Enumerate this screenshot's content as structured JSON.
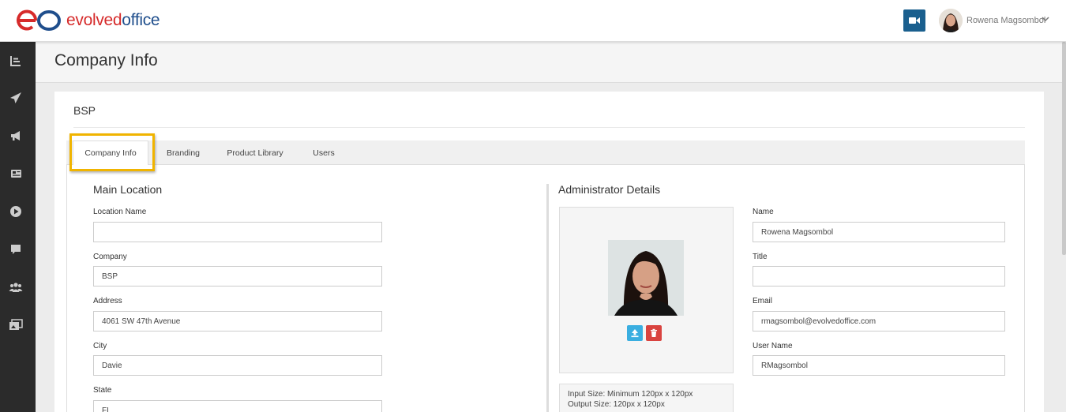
{
  "brand": {
    "word1": "evolved",
    "word2": "office",
    "red": "#d62b2b",
    "blue": "#1f4e8c"
  },
  "topbar": {
    "video_icon": "video-camera-icon",
    "user_name": "Rowena Magsombol"
  },
  "sidebar": {
    "icons": [
      "chart-bar-icon",
      "paper-plane-icon",
      "megaphone-icon",
      "newspaper-icon",
      "play-circle-icon",
      "comment-icon",
      "users-icon",
      "images-icon"
    ]
  },
  "page": {
    "title": "Company Info"
  },
  "card": {
    "company_name": "BSP"
  },
  "tabs": [
    {
      "label": "Company Info",
      "active": true
    },
    {
      "label": "Branding"
    },
    {
      "label": "Product Library"
    },
    {
      "label": "Users"
    }
  ],
  "main_location": {
    "title": "Main Location",
    "fields": [
      {
        "label": "Location Name",
        "value": ""
      },
      {
        "label": "Company",
        "value": "BSP"
      },
      {
        "label": "Address",
        "value": "4061 SW 47th Avenue"
      },
      {
        "label": "City",
        "value": "Davie"
      },
      {
        "label": "State",
        "value": "FL"
      }
    ]
  },
  "admin": {
    "title": "Administrator Details",
    "fields": [
      {
        "label": "Name",
        "value": "Rowena Magsombol"
      },
      {
        "label": "Title",
        "value": ""
      },
      {
        "label": "Email",
        "value": "rmagsombol@evolvedoffice.com"
      },
      {
        "label": "User Name",
        "value": "RMagsombol"
      }
    ],
    "upload_color": "#3aaee0",
    "delete_color": "#d9433f",
    "input_size": "Input Size: Minimum 120px x 120px",
    "output_size": "Output Size: 120px x 120px"
  }
}
